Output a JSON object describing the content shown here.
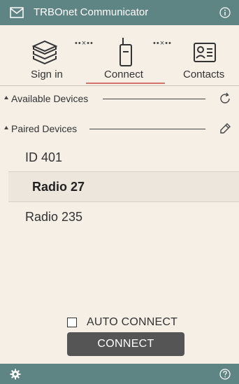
{
  "app": {
    "title": "TRBOnet Communicator",
    "bar_color": "#5e8583",
    "accent_color": "#d4736b"
  },
  "tabs": [
    {
      "label": "Sign in",
      "icon": "server-icon",
      "active": false
    },
    {
      "label": "Connect",
      "icon": "radio-icon",
      "active": true
    },
    {
      "label": "Contacts",
      "icon": "contact-card-icon",
      "active": false
    }
  ],
  "connection_indicators": [
    "••×••",
    "••×••"
  ],
  "sections": {
    "available": {
      "label": "Available Devices",
      "action_icon": "refresh-icon"
    },
    "paired": {
      "label": "Paired Devices",
      "action_icon": "edit-icon"
    }
  },
  "devices": [
    {
      "name": "ID 401",
      "selected": false
    },
    {
      "name": "Radio 27",
      "selected": true
    },
    {
      "name": "Radio 235",
      "selected": false
    }
  ],
  "auto_connect": {
    "label": "AUTO CONNECT",
    "checked": false
  },
  "connect_button": {
    "label": "CONNECT"
  },
  "bottom_bar": {
    "left_icon": "gear-icon",
    "right_icon": "help-icon"
  }
}
